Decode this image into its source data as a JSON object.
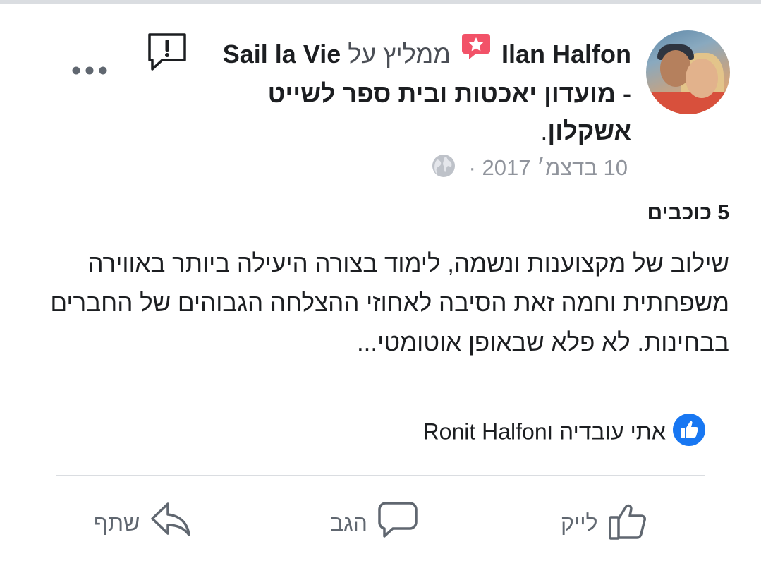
{
  "post": {
    "author": "Ilan Halfon",
    "recommends": "ממליץ על",
    "page_name": "Sail la Vie - מועדון יאכטות ובית ספר לשייט אשקלון",
    "period": ".",
    "date": "10 בדצמ׳ 2017",
    "separator": "·",
    "rating": "5 כוכבים",
    "body": "שילוב של מקצוענות ונשמה, לימוד בצורה היעילה ביותר באווירה משפחתית וחמה זאת הסיבה לאחוזי ההצלחה הגבוהים של החברים בבחינות. לא פלא שבאופן אוטומטי..."
  },
  "reactions": {
    "likers": "אתי עובדיה וRonit Halfon"
  },
  "actions": {
    "like_label": "לייק",
    "comment_label": "הגב",
    "share_label": "שתף"
  },
  "colors": {
    "accent": "#1877f2",
    "badge": "#f25268",
    "muted": "#90949c"
  },
  "icons": {
    "report": "report-icon",
    "more": "more-icon",
    "privacy": "globe-icon",
    "recommend": "recommend-badge-icon"
  }
}
